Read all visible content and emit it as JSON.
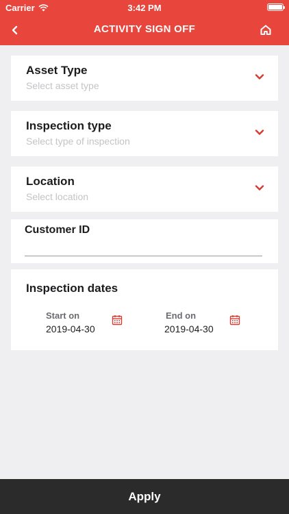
{
  "status_bar": {
    "carrier": "Carrier",
    "time": "3:42 PM"
  },
  "nav": {
    "title": "ACTIVITY SIGN OFF",
    "back_icon": "chevron-left-icon",
    "home_icon": "home-icon"
  },
  "filters": {
    "asset_type": {
      "label": "Asset Type",
      "placeholder": "Select asset type"
    },
    "inspection_type": {
      "label": "Inspection type",
      "placeholder": "Select type of inspection"
    },
    "location": {
      "label": "Location",
      "placeholder": "Select location"
    },
    "customer_id": {
      "label": "Customer ID",
      "value": ""
    }
  },
  "dates": {
    "title": "Inspection dates",
    "start": {
      "label": "Start on",
      "value": "2019-04-30"
    },
    "end": {
      "label": "End on",
      "value": "2019-04-30"
    }
  },
  "apply_label": "Apply",
  "colors": {
    "accent": "#e8453c",
    "bottom_bar": "#2b2b2b",
    "background": "#efeff1"
  }
}
